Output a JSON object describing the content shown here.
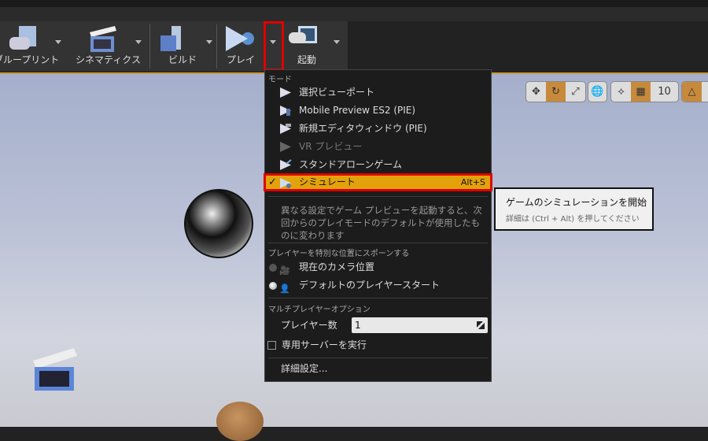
{
  "toolbar": {
    "items": [
      {
        "label": "ブループリント",
        "icon": "blueprint-icon"
      },
      {
        "label": "シネマティクス",
        "icon": "cinematics-icon"
      },
      {
        "label": "ビルド",
        "icon": "build-icon"
      },
      {
        "label": "プレイ",
        "icon": "play-icon"
      },
      {
        "label": "起動",
        "icon": "launch-icon"
      }
    ]
  },
  "menu": {
    "mode_label": "モード",
    "modes": [
      {
        "label": "選択ビューポート",
        "icon": "play-icon"
      },
      {
        "label": "Mobile Preview ES2 (PIE)",
        "icon": "mobile-play-icon"
      },
      {
        "label": "新規エディタウィンドウ (PIE)",
        "icon": "window-play-icon"
      },
      {
        "label": "VR プレビュー",
        "icon": "vr-play-icon",
        "disabled": true
      },
      {
        "label": "スタンドアローンゲーム",
        "icon": "standalone-play-icon"
      }
    ],
    "selected": {
      "label": "シミュレート",
      "shortcut": "Alt+S",
      "check": "✓"
    },
    "description": "異なる設定でゲーム プレビューを起動すると、次回からのプレイモードのデフォルトが使用したものに変わります",
    "spawn_label": "プレイヤーを特別な位置にスポーンする",
    "spawn_options": [
      {
        "label": "現在のカメラ位置",
        "selected": false
      },
      {
        "label": "デフォルトのプレイヤースタート",
        "selected": true
      }
    ],
    "multiplayer_label": "マルチプレイヤーオプション",
    "players_label": "プレイヤー数",
    "players_value": "1",
    "dedicated_server": "専用サーバーを実行",
    "advanced": "詳細設定..."
  },
  "tooltip": {
    "title": "ゲームのシミュレーションを開始",
    "detail": "詳細は (Ctrl + Alt) を押してください"
  },
  "viewport_tools": {
    "grid_snap": "10"
  },
  "colors": {
    "highlight": "#e3a20b",
    "annotation": "#e00000"
  }
}
